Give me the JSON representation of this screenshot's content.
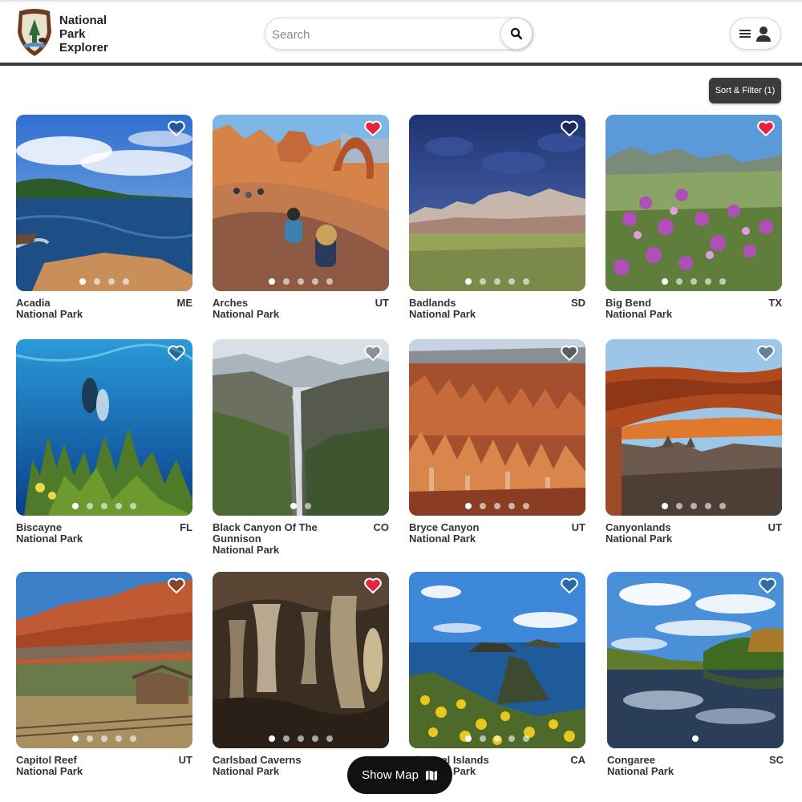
{
  "brand": {
    "line1": "National",
    "line2": "Park",
    "line3": "Explorer",
    "logo_icon": "nps-arrowhead-icon"
  },
  "search": {
    "placeholder": "Search",
    "value": ""
  },
  "sort_filter": {
    "label": "Sort & Filter (1)"
  },
  "map_button": {
    "label": "Show Map"
  },
  "colors": {
    "header_bar": "#3a3a3a",
    "favorite": "#e8223f",
    "button_dark": "#3b3b3b"
  },
  "parks": [
    {
      "name": "Acadia",
      "type": "National Park",
      "state": "ME",
      "favorite": false,
      "photos": 4,
      "active_photo": 0
    },
    {
      "name": "Arches",
      "type": "National Park",
      "state": "UT",
      "favorite": true,
      "photos": 5,
      "active_photo": 0
    },
    {
      "name": "Badlands",
      "type": "National Park",
      "state": "SD",
      "favorite": false,
      "photos": 5,
      "active_photo": 0
    },
    {
      "name": "Big Bend",
      "type": "National Park",
      "state": "TX",
      "favorite": true,
      "photos": 5,
      "active_photo": 0
    },
    {
      "name": "Biscayne",
      "type": "National Park",
      "state": "FL",
      "favorite": false,
      "photos": 5,
      "active_photo": 0
    },
    {
      "name": "Black Canyon Of The Gunnison",
      "type": "National Park",
      "state": "CO",
      "favorite": false,
      "photos": 2,
      "active_photo": 0
    },
    {
      "name": "Bryce Canyon",
      "type": "National Park",
      "state": "UT",
      "favorite": false,
      "photos": 5,
      "active_photo": 0
    },
    {
      "name": "Canyonlands",
      "type": "National Park",
      "state": "UT",
      "favorite": false,
      "photos": 5,
      "active_photo": 0
    },
    {
      "name": "Capitol Reef",
      "type": "National Park",
      "state": "UT",
      "favorite": false,
      "photos": 5,
      "active_photo": 0
    },
    {
      "name": "Carlsbad Caverns",
      "type": "National Park",
      "state": "",
      "favorite": true,
      "photos": 5,
      "active_photo": 0
    },
    {
      "name": "Channel Islands",
      "type": "National Park",
      "state": "CA",
      "favorite": false,
      "photos": 5,
      "active_photo": 0
    },
    {
      "name": "Congaree",
      "type": "National Park",
      "state": "SC",
      "favorite": false,
      "photos": 1,
      "active_photo": 0
    }
  ]
}
